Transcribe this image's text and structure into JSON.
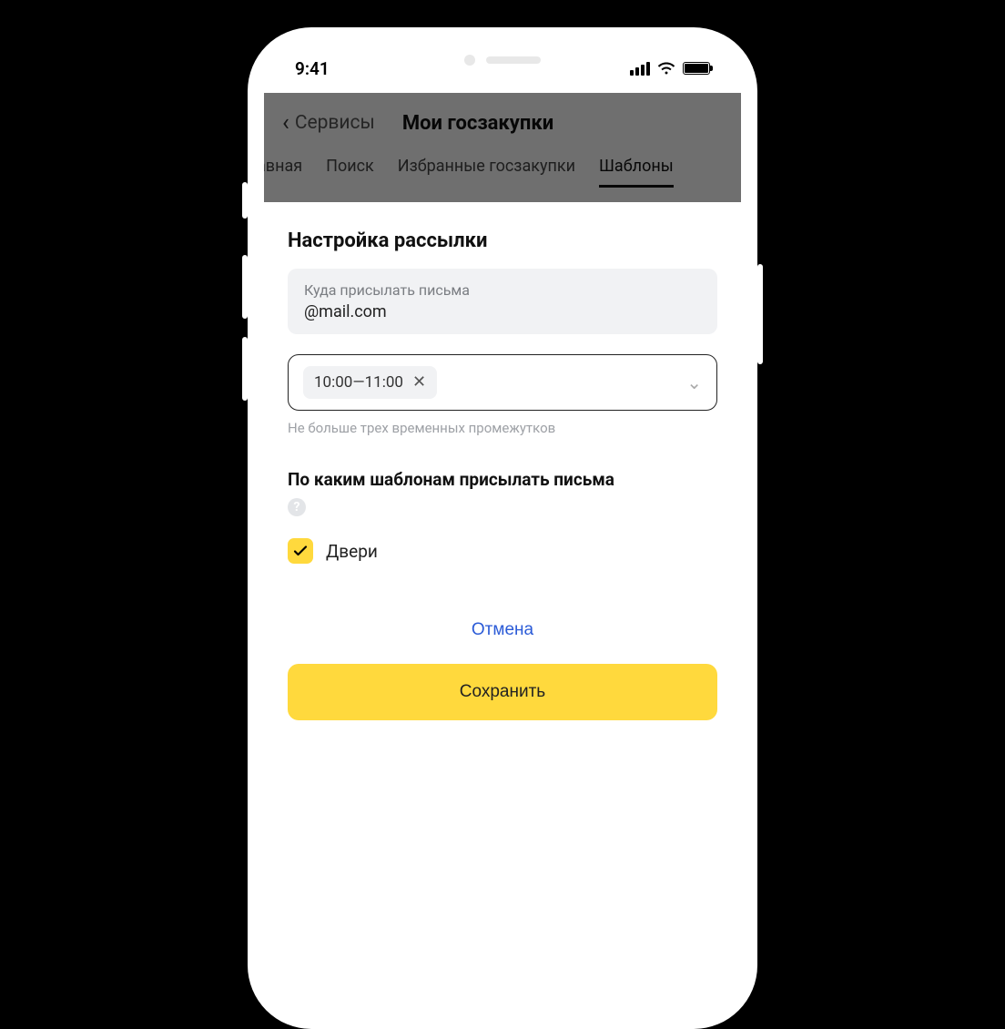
{
  "status": {
    "time": "9:41"
  },
  "nav": {
    "back_label": "Сервисы",
    "title": "Мои госзакупки"
  },
  "tabs": [
    "авная",
    "Поиск",
    "Избранные госзакупки",
    "Шаблоны"
  ],
  "active_tab_index": 3,
  "modal": {
    "section_title": "Настройка рассылки",
    "email": {
      "label": "Куда присылать письма",
      "value": "@mail.com",
      "prefix_blurred": "   "
    },
    "time_chip": "10:00—11:00",
    "time_hint": "Не больше трех временных промежутков",
    "templates_title": "По каким шаблонам присылать письма",
    "templates": [
      {
        "label": "Двери",
        "checked": true
      }
    ],
    "cancel_label": "Отмена",
    "save_label": "Сохранить"
  }
}
